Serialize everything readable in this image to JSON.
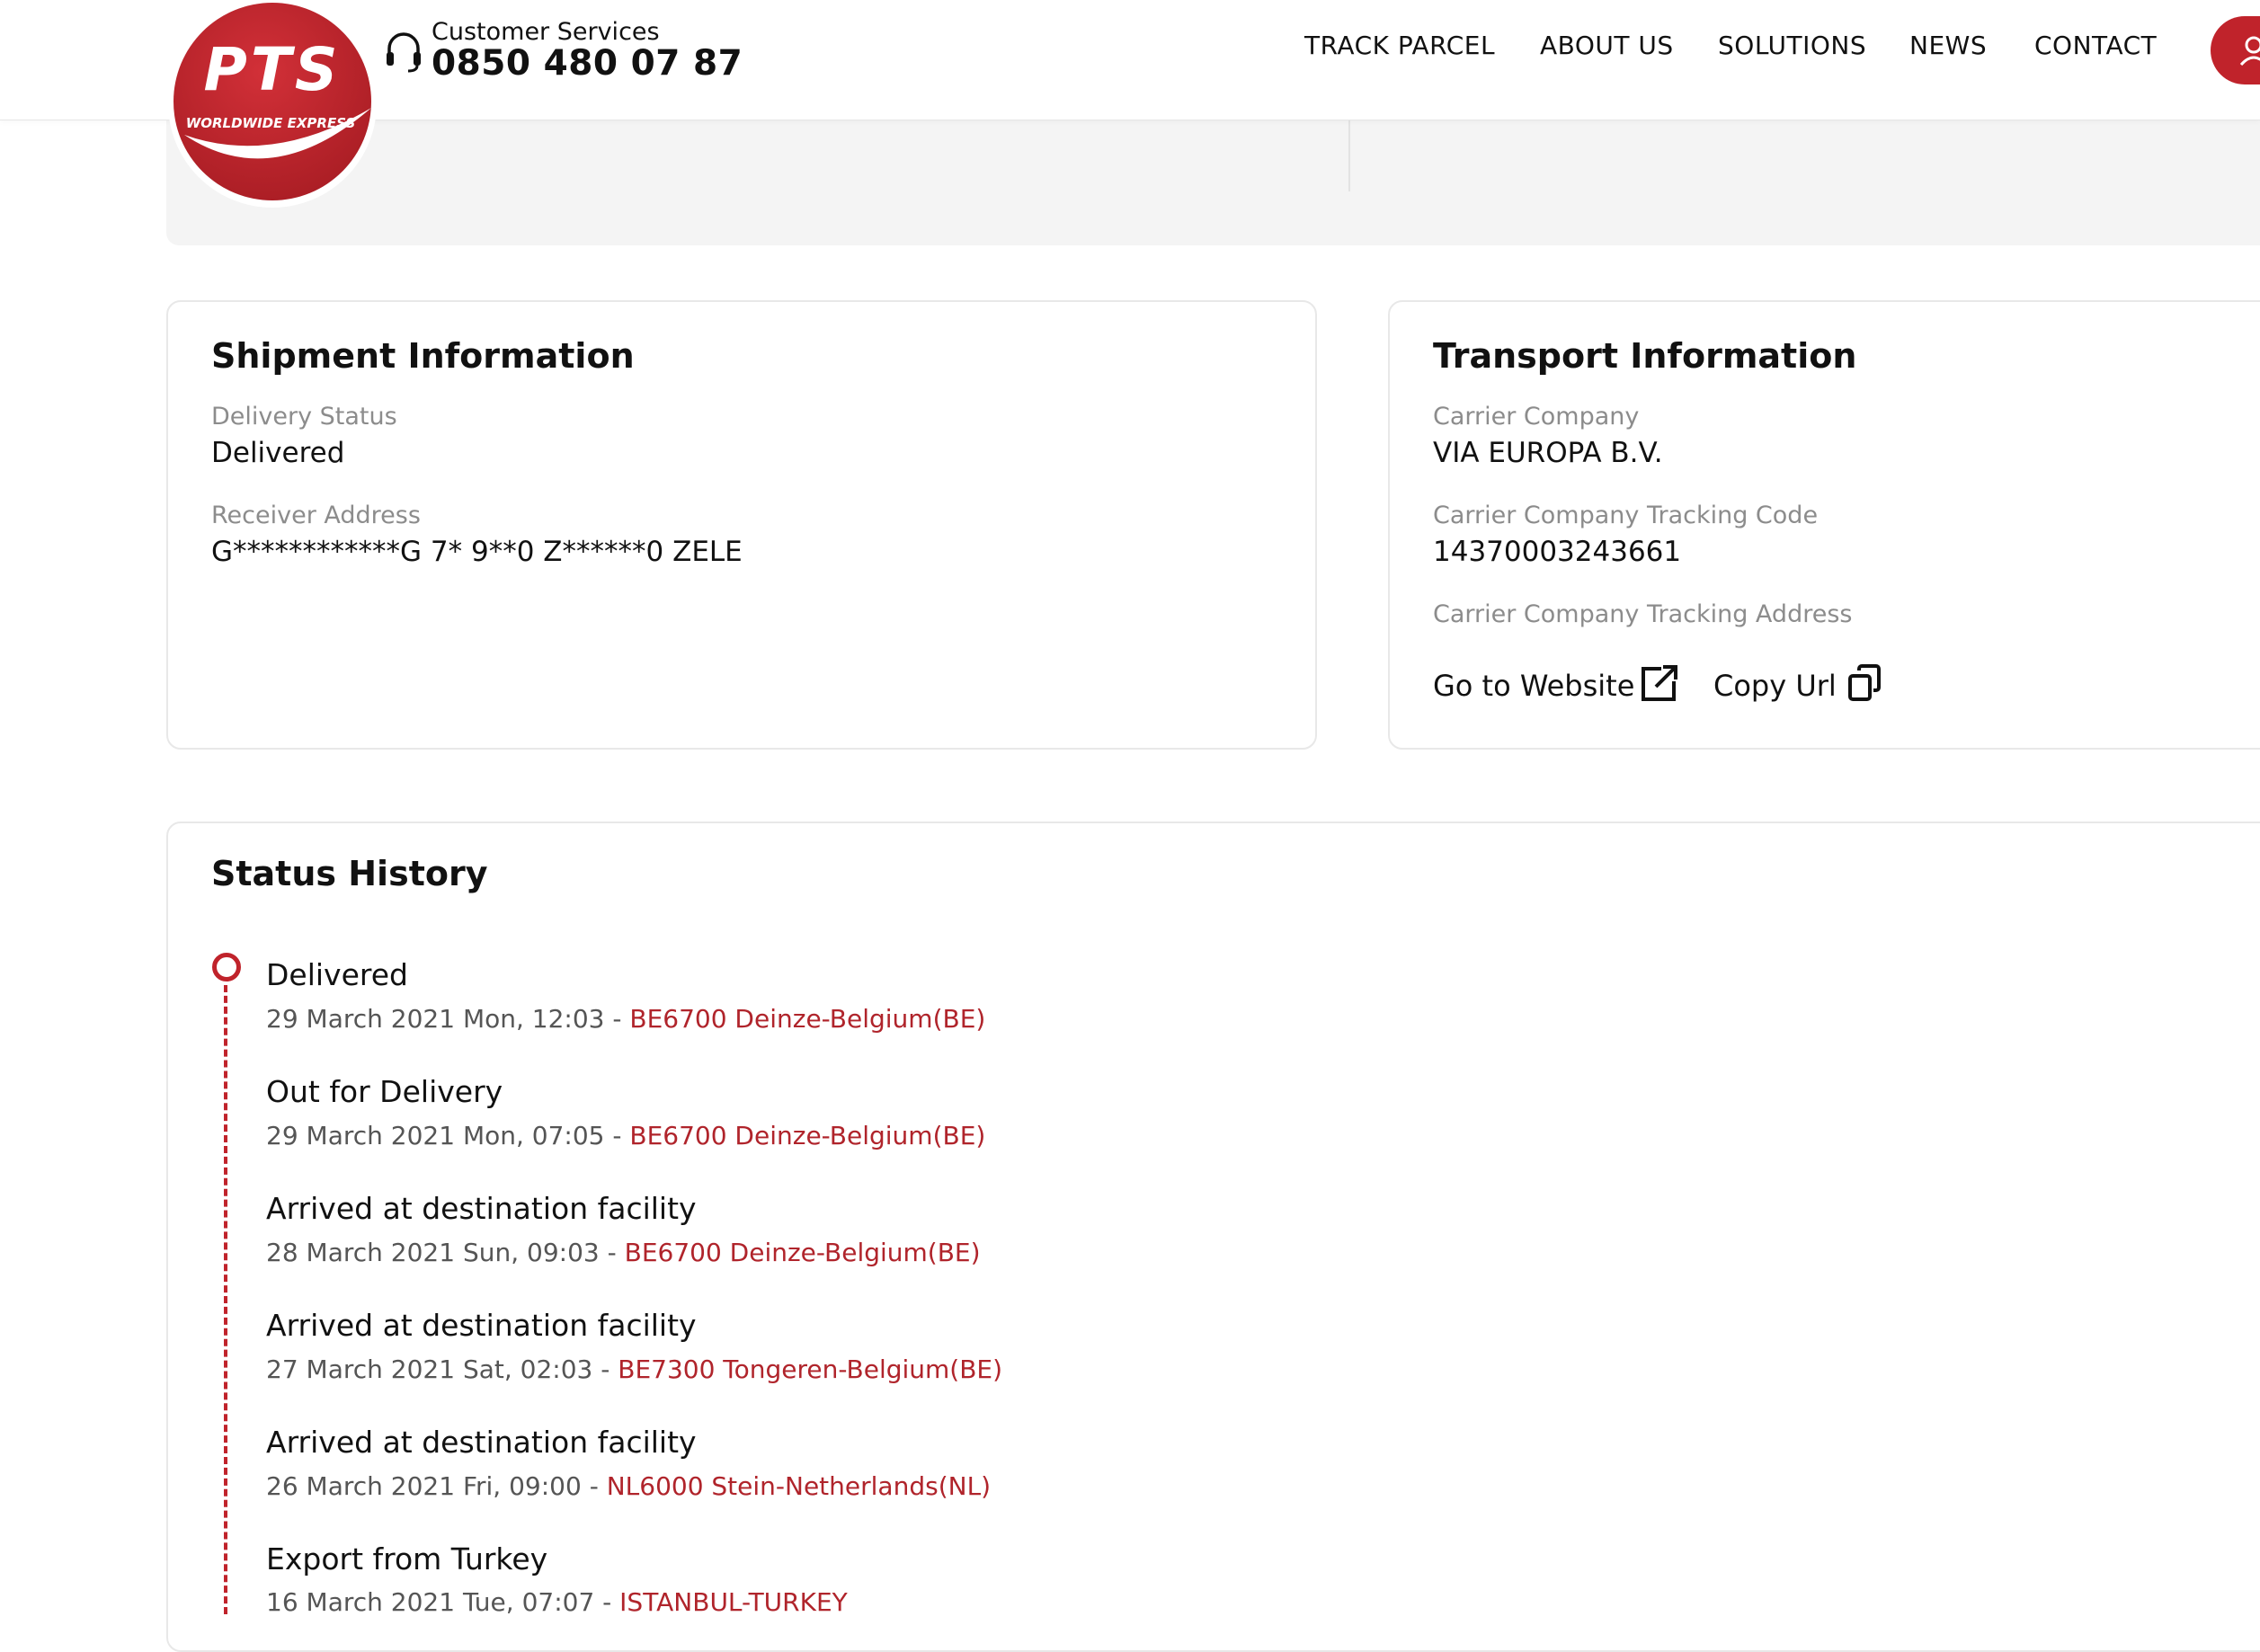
{
  "header": {
    "logo_text": "PTS",
    "logo_subtext": "WORLDWIDE EXPRESS",
    "customer_services_label": "Customer Services",
    "customer_services_phone": "0850 480 07 87",
    "nav": [
      "TRACK PARCEL",
      "ABOUT US",
      "SOLUTIONS",
      "NEWS",
      "CONTACT"
    ]
  },
  "shipment": {
    "title": "Shipment Information",
    "delivery_status_label": "Delivery Status",
    "delivery_status_value": "Delivered",
    "receiver_address_label": "Receiver Address",
    "receiver_address_value": "G************G 7* 9**0 Z******0 ZELE"
  },
  "transport": {
    "title": "Transport Information",
    "carrier_company_label": "Carrier Company",
    "carrier_company_value": "VIA EUROPA B.V.",
    "tracking_code_label": "Carrier Company Tracking Code",
    "tracking_code_value": "14370003243661",
    "tracking_address_label": "Carrier Company Tracking Address",
    "go_to_website": "Go to Website",
    "copy_url": "Copy Url"
  },
  "status_history": {
    "title": "Status History",
    "events": [
      {
        "status": "Delivered",
        "datetime": "29 March 2021 Mon, 12:03",
        "separator": " - ",
        "location": "BE6700 Deinze-Belgium(BE)"
      },
      {
        "status": "Out for Delivery",
        "datetime": "29 March 2021 Mon, 07:05",
        "separator": " - ",
        "location": "BE6700 Deinze-Belgium(BE)"
      },
      {
        "status": "Arrived at destination facility",
        "datetime": "28 March 2021 Sun, 09:03",
        "separator": " - ",
        "location": "BE6700 Deinze-Belgium(BE)"
      },
      {
        "status": "Arrived at destination facility",
        "datetime": "27 March 2021 Sat, 02:03",
        "separator": " - ",
        "location": "BE7300 Tongeren-Belgium(BE)"
      },
      {
        "status": "Arrived at destination facility",
        "datetime": "26 March 2021 Fri, 09:00",
        "separator": " - ",
        "location": "NL6000 Stein-Netherlands(NL)"
      },
      {
        "status": "Export from Turkey",
        "datetime": "16 March 2021 Tue, 07:07",
        "separator": " - ",
        "location": "ISTANBUL-TURKEY"
      }
    ]
  },
  "colors": {
    "brand_red": "#c0232b",
    "location_red": "#b0242b",
    "label_gray": "#8c8c8c"
  }
}
